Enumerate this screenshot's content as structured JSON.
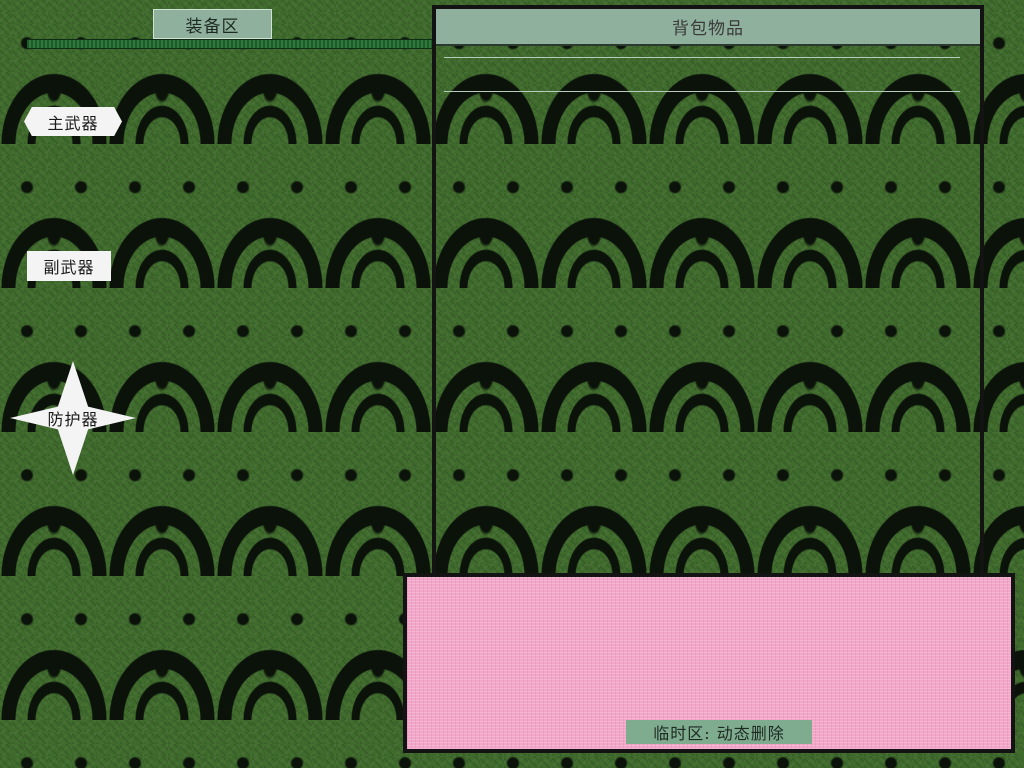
{
  "equipment": {
    "title": "装备区",
    "slots": [
      {
        "id": "main_weapon",
        "label": "主武器",
        "shape": "hexagon"
      },
      {
        "id": "secondary_weapon",
        "label": "副武器",
        "shape": "rectangle"
      },
      {
        "id": "armor",
        "label": "防护器",
        "shape": "star"
      }
    ]
  },
  "backpack": {
    "title": "背包物品"
  },
  "temp_zone": {
    "label": "临时区: 动态删除",
    "background_color": "#f4a6c9"
  },
  "colors": {
    "background": "#3f6b2c",
    "tab": "#8fb09c",
    "border": "#131313"
  }
}
